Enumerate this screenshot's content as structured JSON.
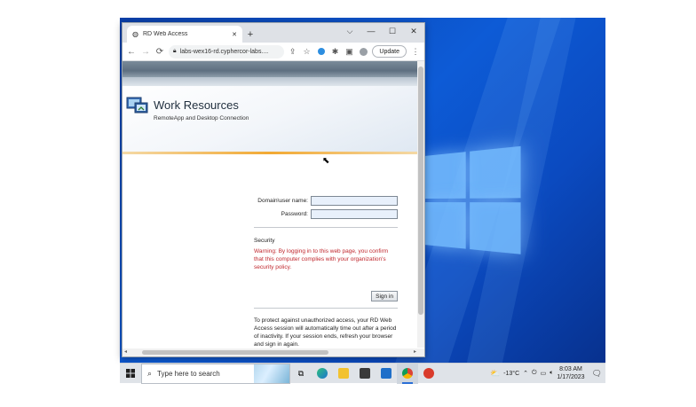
{
  "browser": {
    "tab_title": "RD Web Access",
    "new_tab_label": "+",
    "controls": {
      "dropdown": "⌵",
      "minimize": "—",
      "maximize": "☐",
      "close": "✕"
    },
    "url": "labs-wex16-rd.cyphercor-labs....",
    "update_label": "Update",
    "back_icon": "←",
    "forward_icon": "→",
    "reload_icon": "⟳",
    "menu_icon": "⋮"
  },
  "page": {
    "title": "Work Resources",
    "subtitle": "RemoteApp and Desktop Connection",
    "domain_label": "Domain\\user name:",
    "domain_value": "",
    "password_label": "Password:",
    "password_value": "",
    "security_title": "Security",
    "security_warning": "Warning: By logging in to this web page, you confirm that this computer complies with your organization's security policy.",
    "signin_label": "Sign in",
    "timeout_text": "To protect against unauthorized access, your RD Web Access session will automatically time out after a period of inactivity. If your session ends, refresh your browser and sign in again."
  },
  "taskbar": {
    "search_placeholder": "Type here to search",
    "weather": "-13°C",
    "time": "8:03 AM",
    "date": "1/17/2023",
    "apps": [
      "task-view",
      "edge",
      "file-explorer",
      "store",
      "mail",
      "chrome",
      "app-red"
    ]
  },
  "colors": {
    "desktop_blue": "#0d5bd6",
    "warning_red": "#c0272d",
    "accent_orange": "#f2a933",
    "taskbar_bg": "#dfe3e8"
  }
}
